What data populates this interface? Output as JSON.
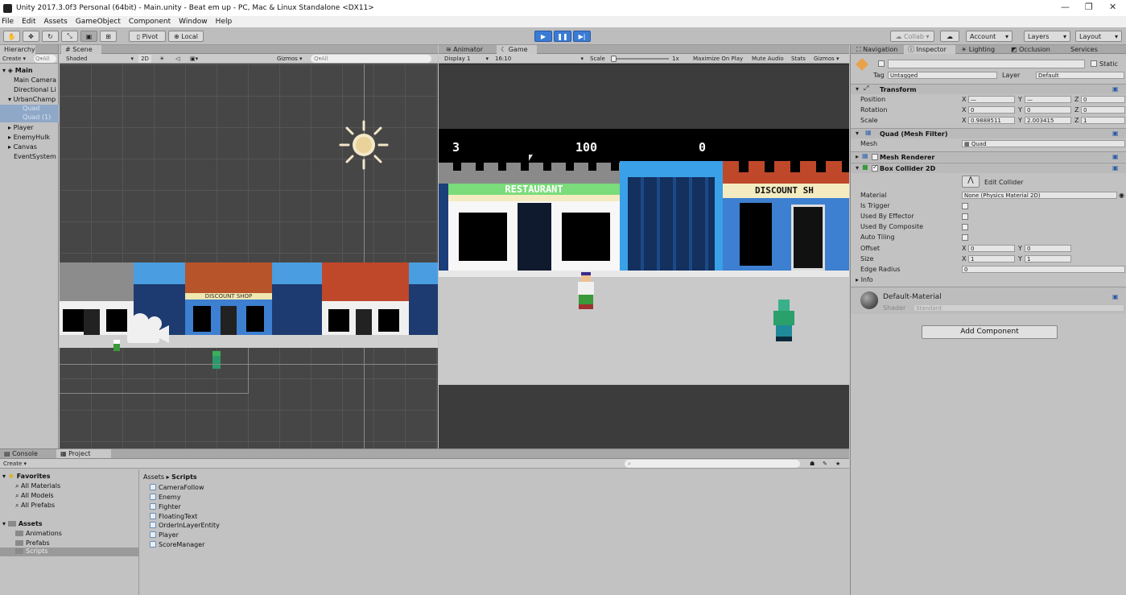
{
  "window": {
    "title": "Unity 2017.3.0f3 Personal (64bit) - Main.unity - Beat em up - PC, Mac & Linux Standalone <DX11>",
    "minimize": "—",
    "maximize": "❐",
    "close": "✕"
  },
  "menu": [
    "File",
    "Edit",
    "Assets",
    "GameObject",
    "Component",
    "Window",
    "Help"
  ],
  "toolbar": {
    "pivot": "Pivot",
    "local": "Local",
    "collab": "Collab ▾",
    "account": "Account",
    "layers": "Layers",
    "layout": "Layout"
  },
  "hierarchy": {
    "tab": "Hierarchy",
    "create": "Create ▾",
    "search": "Q▾All",
    "items": [
      "Main",
      "Main Camera",
      "Directional Li",
      "UrbanChamp",
      "Quad",
      "Quad (1)",
      "Player",
      "EnemyHulk",
      "Canvas",
      "EventSystem"
    ]
  },
  "scene": {
    "tab": "Scene",
    "shaded": "Shaded",
    "mode2d": "2D",
    "gizmos": "Gizmos ▾",
    "search": "Q▾All",
    "signs": [
      "DISCOUNT SHOP"
    ]
  },
  "game": {
    "tabs": [
      "Animator",
      "Game"
    ],
    "display": "Display 1",
    "aspect": "16:10",
    "scale_label": "Scale",
    "scale_value": "1x",
    "options": [
      "Maximize On Play",
      "Mute Audio",
      "Stats",
      "Gizmos ▾"
    ],
    "hud": {
      "lives": "3",
      "score": "100",
      "right": "0"
    },
    "signs": {
      "restaurant": "RESTAURANT",
      "discount": "DISCOUNT SH"
    }
  },
  "inspector": {
    "tabs": [
      "Navigation",
      "Inspector",
      "Lighting",
      "Occlusion",
      "Services"
    ],
    "static_label": "Static",
    "tag_label": "Tag",
    "tag_value": "Untagged",
    "layer_label": "Layer",
    "layer_value": "Default",
    "transform": {
      "header": "Transform",
      "position": {
        "label": "Position",
        "x": "—",
        "y": "—",
        "z": "0"
      },
      "rotation": {
        "label": "Rotation",
        "x": "0",
        "y": "0",
        "z": "0"
      },
      "scale": {
        "label": "Scale",
        "x": "0.9888511",
        "y": "2.003415",
        "z": "1"
      }
    },
    "mesh_filter": {
      "header": "Quad (Mesh Filter)",
      "mesh_label": "Mesh",
      "mesh_value": "Quad"
    },
    "mesh_renderer": {
      "header": "Mesh Renderer"
    },
    "box_collider": {
      "header": "Box Collider 2D",
      "edit": "Edit Collider",
      "material_label": "Material",
      "material_value": "None (Physics Material 2D)",
      "is_trigger": "Is Trigger",
      "used_by_effector": "Used By Effector",
      "used_by_composite": "Used By Composite",
      "auto_tiling": "Auto Tiling",
      "offset": {
        "label": "Offset",
        "x": "0",
        "y": "0"
      },
      "size": {
        "label": "Size",
        "x": "1",
        "y": "1"
      },
      "edge_radius": {
        "label": "Edge Radius",
        "value": "0"
      },
      "info": "Info"
    },
    "material": {
      "name": "Default-Material",
      "shader_label": "Shader",
      "shader_value": "Standard"
    },
    "add_component": "Add Component",
    "axes": {
      "x": "X",
      "y": "Y",
      "z": "Z"
    }
  },
  "bottom": {
    "tabs": [
      "Console",
      "Project"
    ],
    "create": "Create ▾",
    "favorites": {
      "header": "Favorites",
      "items": [
        "All Materials",
        "All Models",
        "All Prefabs"
      ]
    },
    "assets": {
      "header": "Assets",
      "items": [
        "Animations",
        "Prefabs",
        "Scripts"
      ]
    },
    "breadcrumb": {
      "root": "Assets",
      "sep": "▸",
      "current": "Scripts"
    },
    "scripts": [
      "CameraFollow",
      "Enemy",
      "Fighter",
      "FloatingText",
      "OrderInLayerEntity",
      "Player",
      "ScoreManager"
    ]
  }
}
